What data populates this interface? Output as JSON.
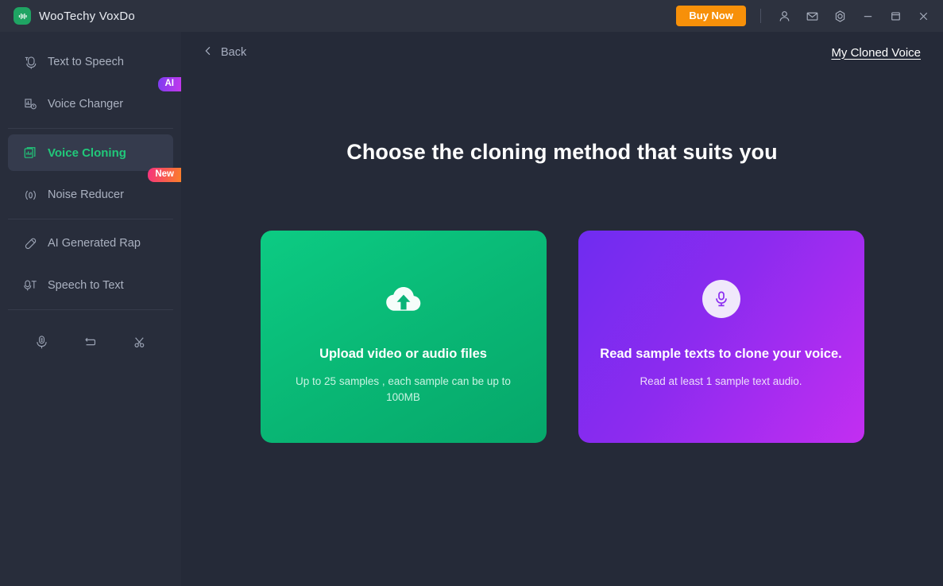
{
  "titlebar": {
    "app_name": "WooTechy VoxDo",
    "logo_icon": "voxdo-logo-icon",
    "buy_now_label": "Buy Now",
    "icons": [
      {
        "name": "account-icon",
        "glyph": "user"
      },
      {
        "name": "mail-icon",
        "glyph": "envelope"
      },
      {
        "name": "settings-icon",
        "glyph": "gear"
      },
      {
        "name": "minimize-icon",
        "glyph": "minus"
      },
      {
        "name": "maximize-icon",
        "glyph": "square"
      },
      {
        "name": "close-icon",
        "glyph": "cross"
      }
    ],
    "accent_color": "#f79009",
    "background": "#2d323f"
  },
  "sidebar": {
    "background": "#282d3b",
    "active_background": "#353b4d",
    "active_color": "#21c87a",
    "items": [
      {
        "label": "Text to Speech",
        "icon": "text-to-speech-icon",
        "active": false,
        "badge": null
      },
      {
        "label": "Voice Changer",
        "icon": "voice-changer-icon",
        "active": false,
        "badge": "AI"
      },
      {
        "label": "Voice Cloning",
        "icon": "voice-cloning-icon",
        "active": true,
        "badge": null
      },
      {
        "label": "Noise Reducer",
        "icon": "noise-reducer-icon",
        "active": false,
        "badge": "New"
      },
      {
        "label": "AI Generated Rap",
        "icon": "ai-generated-rap-icon",
        "active": false,
        "badge": null
      },
      {
        "label": "Speech to Text",
        "icon": "speech-to-text-icon",
        "active": false,
        "badge": null
      }
    ],
    "badge_colors": {
      "ai": "#a333ee",
      "new": "#f7567a"
    },
    "tools": [
      {
        "name": "recorder-tool-icon",
        "glyph": "microphone"
      },
      {
        "name": "converter-tool-icon",
        "glyph": "loop"
      },
      {
        "name": "cutter-tool-icon",
        "glyph": "scissors"
      }
    ]
  },
  "main": {
    "back_label": "Back",
    "back_icon": "chevron-left-icon",
    "my_cloned_voice_label": "My Cloned Voice",
    "page_title": "Choose the cloning method that suits you",
    "cards": [
      {
        "id": "upload",
        "icon": "cloud-upload-icon",
        "title": "Upload video or audio files",
        "subtitle": "Up to 25 samples , each sample can be up to 100MB",
        "color_from": "#0ccb83",
        "color_to": "#06a76a"
      },
      {
        "id": "read",
        "icon": "microphone-icon",
        "title": "Read sample texts to clone your voice.",
        "subtitle": "Read at least 1 sample text audio.",
        "color_from": "#6f2cf0",
        "color_to": "#c32ef1"
      }
    ]
  }
}
